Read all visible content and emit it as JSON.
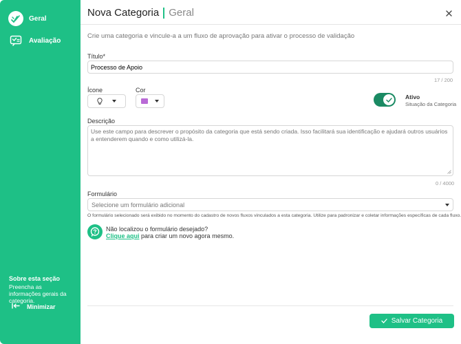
{
  "sidebar": {
    "items": [
      {
        "label": "Geral",
        "icon": "approval-check-icon",
        "active": true
      },
      {
        "label": "Avaliação",
        "icon": "review-card-icon",
        "active": false
      }
    ],
    "about_title": "Sobre esta seção",
    "about_text": "Preencha as informações gerais da categoria.",
    "minimize_label": "Minimizar"
  },
  "header": {
    "title": "Nova Categoria",
    "subtitle": "Geral"
  },
  "main": {
    "intro": "Crie uma categoria e vincule-a a um fluxo de aprovação para ativar o processo de validação",
    "titulo": {
      "label": "Título*",
      "value": "Processo de Apoio",
      "counter": "17 / 200"
    },
    "icone_label": "Ícone",
    "icone_value": "lightbulb-icon",
    "cor_label": "Cor",
    "cor_value": "#b96ad6",
    "ativo_label": "Ativo",
    "ativo_sub": "Situação da Categoria",
    "ativo_on": true,
    "descricao": {
      "label": "Descrição",
      "placeholder": "Use este campo para descrever o propósito da categoria que está sendo criada. Isso facilitará sua identificação e ajudará outros usuários a entenderem quando e como utilizá-la.",
      "counter": "0 / 4000"
    },
    "formulario": {
      "label": "Formulário",
      "placeholder": "Selecione um formulário adicional",
      "help": "O formulário selecionado será exibido no momento do cadastro de novos fluxos vinculados a esta categoria. Utilize para padronizar e coletar informações específicas de cada fluxo."
    },
    "tip": {
      "question": "Não localizou o formulário desejado?",
      "link": "Clique aqui",
      "rest": " para criar um novo agora mesmo."
    },
    "save_label": "Salvar Categoria"
  },
  "colors": {
    "accent": "#1ec086",
    "toggle": "#1a8a63"
  }
}
